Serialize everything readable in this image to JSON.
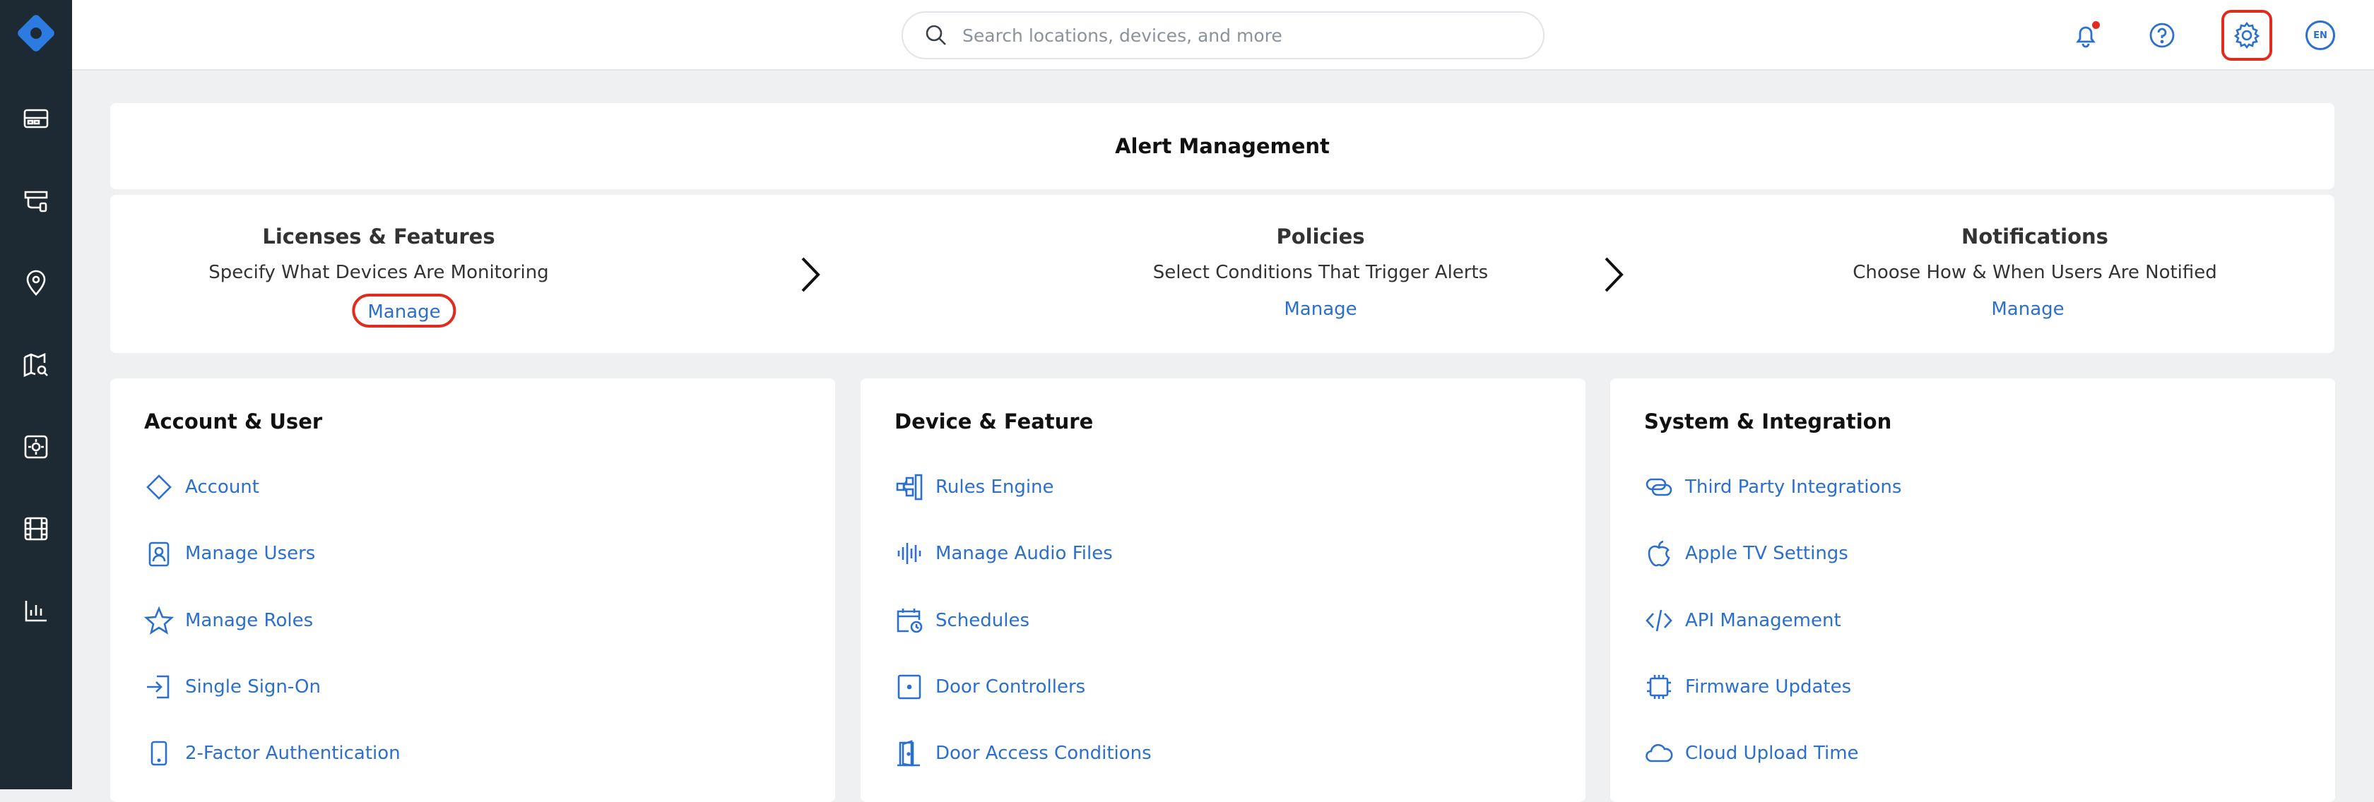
{
  "search": {
    "placeholder": "Search locations, devices, and more"
  },
  "topbar": {
    "language": "EN"
  },
  "colors": {
    "accent": "#2b6fcf",
    "highlight": "#e02c1f",
    "sidebar": "#1e2a33"
  },
  "sidebar": {
    "items": [
      {
        "icon": "dashboard-icon"
      },
      {
        "icon": "devices-icon"
      },
      {
        "icon": "location-pin-icon"
      },
      {
        "icon": "map-search-icon"
      },
      {
        "icon": "alarm-panel-icon"
      },
      {
        "icon": "film-icon"
      },
      {
        "icon": "analytics-icon"
      }
    ]
  },
  "alert_management": {
    "title": "Alert Management",
    "steps": [
      {
        "title": "Licenses & Features",
        "desc": "Specify What Devices Are Monitoring",
        "link": "Manage"
      },
      {
        "title": "Policies",
        "desc": "Select Conditions That Trigger Alerts",
        "link": "Manage"
      },
      {
        "title": "Notifications",
        "desc": "Choose How & When Users Are Notified",
        "link": "Manage"
      }
    ]
  },
  "sections": [
    {
      "title": "Account & User",
      "links": [
        {
          "label": "Account",
          "icon": "diamond-icon"
        },
        {
          "label": "Manage Users",
          "icon": "user-badge-icon"
        },
        {
          "label": "Manage Roles",
          "icon": "star-icon"
        },
        {
          "label": "Single Sign-On",
          "icon": "sign-in-icon"
        },
        {
          "label": "2-Factor Authentication",
          "icon": "phone-icon"
        }
      ]
    },
    {
      "title": "Device & Feature",
      "links": [
        {
          "label": "Rules Engine",
          "icon": "rules-icon"
        },
        {
          "label": "Manage Audio Files",
          "icon": "audio-wave-icon"
        },
        {
          "label": "Schedules",
          "icon": "calendar-clock-icon"
        },
        {
          "label": "Door Controllers",
          "icon": "door-controller-icon"
        },
        {
          "label": "Door Access Conditions",
          "icon": "door-icon"
        }
      ]
    },
    {
      "title": "System & Integration",
      "links": [
        {
          "label": "Third Party Integrations",
          "icon": "link-icon"
        },
        {
          "label": "Apple TV Settings",
          "icon": "apple-icon"
        },
        {
          "label": "API Management",
          "icon": "code-icon"
        },
        {
          "label": "Firmware Updates",
          "icon": "chip-icon"
        },
        {
          "label": "Cloud Upload Time",
          "icon": "cloud-icon"
        }
      ]
    }
  ]
}
